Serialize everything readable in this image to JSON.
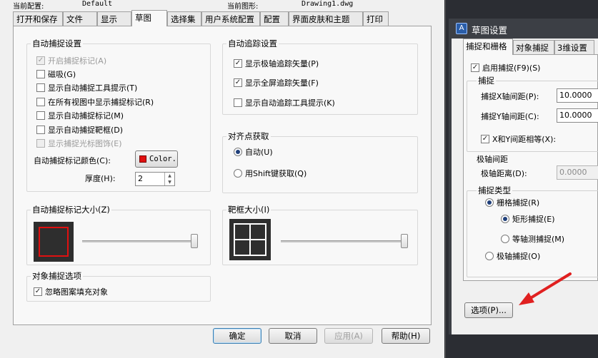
{
  "header": {
    "current_profile_label": "当前配置:",
    "current_profile_value": "Default",
    "current_drawing_label": "当前图形:",
    "current_drawing_value": "Drawing1.dwg"
  },
  "tabs": [
    "打开和保存",
    "文件",
    "显示",
    "草图",
    "选择集",
    "用户系统配置",
    "配置",
    "界面皮肤和主题",
    "打印"
  ],
  "autosnap": {
    "title": "自动捕捉设置",
    "items": [
      {
        "label": "开启捕捉标记(A)",
        "checked": true,
        "disabled": true
      },
      {
        "label": "磁吸(G)",
        "checked": false,
        "disabled": false
      },
      {
        "label": "显示自动捕捉工具提示(T)",
        "checked": false,
        "disabled": false
      },
      {
        "label": "在所有视图中显示捕捉标记(R)",
        "checked": false,
        "disabled": false
      },
      {
        "label": "显示自动捕捉标记(M)",
        "checked": false,
        "disabled": false
      },
      {
        "label": "显示自动捕捉靶框(D)",
        "checked": false,
        "disabled": false
      },
      {
        "label": "显示捕捉光标图饰(E)",
        "checked": false,
        "disabled": true
      }
    ],
    "color_label": "自动捕捉标记颜色(C):",
    "color_button": "Color.",
    "color_value": "#e01010",
    "thickness_label": "厚度(H):",
    "thickness_value": "2"
  },
  "marker_size": {
    "title": "自动捕捉标记大小(Z)",
    "slider_fraction": 1.0
  },
  "object_snap": {
    "title": "对象捕捉选项",
    "ignore_hatch_label": "忽略图案填充对象",
    "ignore_hatch_checked": true
  },
  "autotrack": {
    "title": "自动追踪设置",
    "items": [
      {
        "label": "显示极轴追踪矢量(P)",
        "checked": true
      },
      {
        "label": "显示全屏追踪矢量(F)",
        "checked": true
      },
      {
        "label": "显示自动追踪工具提示(K)",
        "checked": false
      }
    ]
  },
  "alignment": {
    "title": "对齐点获取",
    "options": [
      {
        "label": "自动(U)",
        "selected": true
      },
      {
        "label": "用Shift键获取(Q)",
        "selected": false
      }
    ]
  },
  "aperture": {
    "title": "靶框大小(I)",
    "slider_fraction": 1.0
  },
  "buttons": {
    "ok": "确定",
    "cancel": "取消",
    "apply": "应用(A)",
    "help": "帮助(H)"
  },
  "sketch_dialog": {
    "title": "草图设置",
    "tabs": [
      "捕捉和栅格",
      "对象捕捉",
      "3维设置"
    ],
    "enable_snap_label": "启用捕捉(F9)(S)",
    "enable_snap_checked": true,
    "snap_group_title": "捕捉",
    "snap_x_label": "捕捉X轴间距(P):",
    "snap_x_value": "10.0000",
    "snap_y_label": "捕捉Y轴间距(C):",
    "snap_y_value": "10.0000",
    "equal_xy_label": "X和Y间距相等(X):",
    "equal_xy_checked": true,
    "polar_group_title": "极轴间距",
    "polar_distance_label": "极轴距离(D):",
    "polar_distance_value": "0.0000",
    "snap_type_title": "捕捉类型",
    "grid_snap_label": "栅格捕捉(R)",
    "rect_snap_label": "矩形捕捉(E)",
    "iso_snap_label": "等轴测捕捉(M)",
    "polar_snap_label": "极轴捕捉(O)",
    "options_button": "选项(P)..."
  },
  "colors": {
    "annotation_arrow": "#e02020",
    "dialog_bg": "#f0f0f0",
    "dark_bg": "#2b2d33"
  }
}
